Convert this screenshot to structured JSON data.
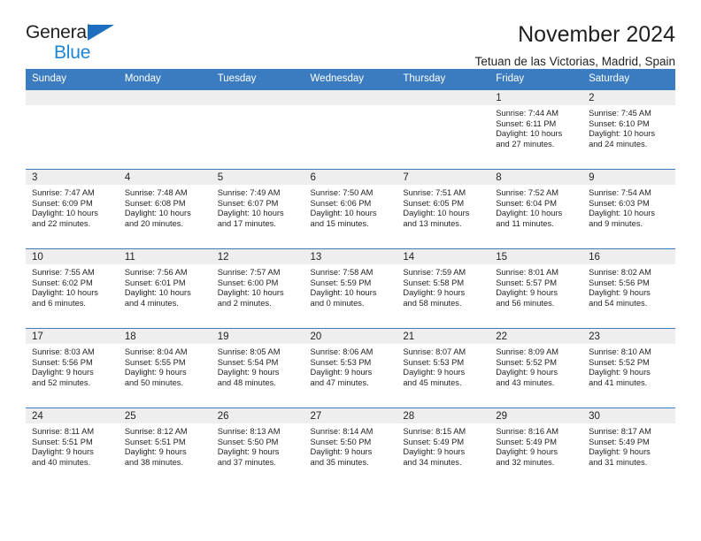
{
  "brand": {
    "word1": "General",
    "word2": "Blue",
    "triangle_color": "#1c6fc0",
    "word2_color": "#1c85d6"
  },
  "header": {
    "title": "November 2024",
    "subtitle": "Tetuan de las Victorias, Madrid, Spain"
  },
  "theme": {
    "header_blue": "#3b7cc0",
    "daynum_gray": "#eeeeee",
    "text": "#231f20"
  },
  "calendar": {
    "weekday_headers": [
      "Sunday",
      "Monday",
      "Tuesday",
      "Wednesday",
      "Thursday",
      "Friday",
      "Saturday"
    ],
    "weeks": [
      [
        {
          "day": "",
          "empty": true,
          "sunrise": "",
          "sunset": "",
          "daylight1": "",
          "daylight2": ""
        },
        {
          "day": "",
          "empty": true,
          "sunrise": "",
          "sunset": "",
          "daylight1": "",
          "daylight2": ""
        },
        {
          "day": "",
          "empty": true,
          "sunrise": "",
          "sunset": "",
          "daylight1": "",
          "daylight2": ""
        },
        {
          "day": "",
          "empty": true,
          "sunrise": "",
          "sunset": "",
          "daylight1": "",
          "daylight2": ""
        },
        {
          "day": "",
          "empty": true,
          "sunrise": "",
          "sunset": "",
          "daylight1": "",
          "daylight2": ""
        },
        {
          "day": "1",
          "sunrise": "Sunrise: 7:44 AM",
          "sunset": "Sunset: 6:11 PM",
          "daylight1": "Daylight: 10 hours",
          "daylight2": "and 27 minutes."
        },
        {
          "day": "2",
          "sunrise": "Sunrise: 7:45 AM",
          "sunset": "Sunset: 6:10 PM",
          "daylight1": "Daylight: 10 hours",
          "daylight2": "and 24 minutes."
        }
      ],
      [
        {
          "day": "3",
          "sunrise": "Sunrise: 7:47 AM",
          "sunset": "Sunset: 6:09 PM",
          "daylight1": "Daylight: 10 hours",
          "daylight2": "and 22 minutes."
        },
        {
          "day": "4",
          "sunrise": "Sunrise: 7:48 AM",
          "sunset": "Sunset: 6:08 PM",
          "daylight1": "Daylight: 10 hours",
          "daylight2": "and 20 minutes."
        },
        {
          "day": "5",
          "sunrise": "Sunrise: 7:49 AM",
          "sunset": "Sunset: 6:07 PM",
          "daylight1": "Daylight: 10 hours",
          "daylight2": "and 17 minutes."
        },
        {
          "day": "6",
          "sunrise": "Sunrise: 7:50 AM",
          "sunset": "Sunset: 6:06 PM",
          "daylight1": "Daylight: 10 hours",
          "daylight2": "and 15 minutes."
        },
        {
          "day": "7",
          "sunrise": "Sunrise: 7:51 AM",
          "sunset": "Sunset: 6:05 PM",
          "daylight1": "Daylight: 10 hours",
          "daylight2": "and 13 minutes."
        },
        {
          "day": "8",
          "sunrise": "Sunrise: 7:52 AM",
          "sunset": "Sunset: 6:04 PM",
          "daylight1": "Daylight: 10 hours",
          "daylight2": "and 11 minutes."
        },
        {
          "day": "9",
          "sunrise": "Sunrise: 7:54 AM",
          "sunset": "Sunset: 6:03 PM",
          "daylight1": "Daylight: 10 hours",
          "daylight2": "and 9 minutes."
        }
      ],
      [
        {
          "day": "10",
          "sunrise": "Sunrise: 7:55 AM",
          "sunset": "Sunset: 6:02 PM",
          "daylight1": "Daylight: 10 hours",
          "daylight2": "and 6 minutes."
        },
        {
          "day": "11",
          "sunrise": "Sunrise: 7:56 AM",
          "sunset": "Sunset: 6:01 PM",
          "daylight1": "Daylight: 10 hours",
          "daylight2": "and 4 minutes."
        },
        {
          "day": "12",
          "sunrise": "Sunrise: 7:57 AM",
          "sunset": "Sunset: 6:00 PM",
          "daylight1": "Daylight: 10 hours",
          "daylight2": "and 2 minutes."
        },
        {
          "day": "13",
          "sunrise": "Sunrise: 7:58 AM",
          "sunset": "Sunset: 5:59 PM",
          "daylight1": "Daylight: 10 hours",
          "daylight2": "and 0 minutes."
        },
        {
          "day": "14",
          "sunrise": "Sunrise: 7:59 AM",
          "sunset": "Sunset: 5:58 PM",
          "daylight1": "Daylight: 9 hours",
          "daylight2": "and 58 minutes."
        },
        {
          "day": "15",
          "sunrise": "Sunrise: 8:01 AM",
          "sunset": "Sunset: 5:57 PM",
          "daylight1": "Daylight: 9 hours",
          "daylight2": "and 56 minutes."
        },
        {
          "day": "16",
          "sunrise": "Sunrise: 8:02 AM",
          "sunset": "Sunset: 5:56 PM",
          "daylight1": "Daylight: 9 hours",
          "daylight2": "and 54 minutes."
        }
      ],
      [
        {
          "day": "17",
          "sunrise": "Sunrise: 8:03 AM",
          "sunset": "Sunset: 5:56 PM",
          "daylight1": "Daylight: 9 hours",
          "daylight2": "and 52 minutes."
        },
        {
          "day": "18",
          "sunrise": "Sunrise: 8:04 AM",
          "sunset": "Sunset: 5:55 PM",
          "daylight1": "Daylight: 9 hours",
          "daylight2": "and 50 minutes."
        },
        {
          "day": "19",
          "sunrise": "Sunrise: 8:05 AM",
          "sunset": "Sunset: 5:54 PM",
          "daylight1": "Daylight: 9 hours",
          "daylight2": "and 48 minutes."
        },
        {
          "day": "20",
          "sunrise": "Sunrise: 8:06 AM",
          "sunset": "Sunset: 5:53 PM",
          "daylight1": "Daylight: 9 hours",
          "daylight2": "and 47 minutes."
        },
        {
          "day": "21",
          "sunrise": "Sunrise: 8:07 AM",
          "sunset": "Sunset: 5:53 PM",
          "daylight1": "Daylight: 9 hours",
          "daylight2": "and 45 minutes."
        },
        {
          "day": "22",
          "sunrise": "Sunrise: 8:09 AM",
          "sunset": "Sunset: 5:52 PM",
          "daylight1": "Daylight: 9 hours",
          "daylight2": "and 43 minutes."
        },
        {
          "day": "23",
          "sunrise": "Sunrise: 8:10 AM",
          "sunset": "Sunset: 5:52 PM",
          "daylight1": "Daylight: 9 hours",
          "daylight2": "and 41 minutes."
        }
      ],
      [
        {
          "day": "24",
          "sunrise": "Sunrise: 8:11 AM",
          "sunset": "Sunset: 5:51 PM",
          "daylight1": "Daylight: 9 hours",
          "daylight2": "and 40 minutes."
        },
        {
          "day": "25",
          "sunrise": "Sunrise: 8:12 AM",
          "sunset": "Sunset: 5:51 PM",
          "daylight1": "Daylight: 9 hours",
          "daylight2": "and 38 minutes."
        },
        {
          "day": "26",
          "sunrise": "Sunrise: 8:13 AM",
          "sunset": "Sunset: 5:50 PM",
          "daylight1": "Daylight: 9 hours",
          "daylight2": "and 37 minutes."
        },
        {
          "day": "27",
          "sunrise": "Sunrise: 8:14 AM",
          "sunset": "Sunset: 5:50 PM",
          "daylight1": "Daylight: 9 hours",
          "daylight2": "and 35 minutes."
        },
        {
          "day": "28",
          "sunrise": "Sunrise: 8:15 AM",
          "sunset": "Sunset: 5:49 PM",
          "daylight1": "Daylight: 9 hours",
          "daylight2": "and 34 minutes."
        },
        {
          "day": "29",
          "sunrise": "Sunrise: 8:16 AM",
          "sunset": "Sunset: 5:49 PM",
          "daylight1": "Daylight: 9 hours",
          "daylight2": "and 32 minutes."
        },
        {
          "day": "30",
          "sunrise": "Sunrise: 8:17 AM",
          "sunset": "Sunset: 5:49 PM",
          "daylight1": "Daylight: 9 hours",
          "daylight2": "and 31 minutes."
        }
      ]
    ]
  }
}
